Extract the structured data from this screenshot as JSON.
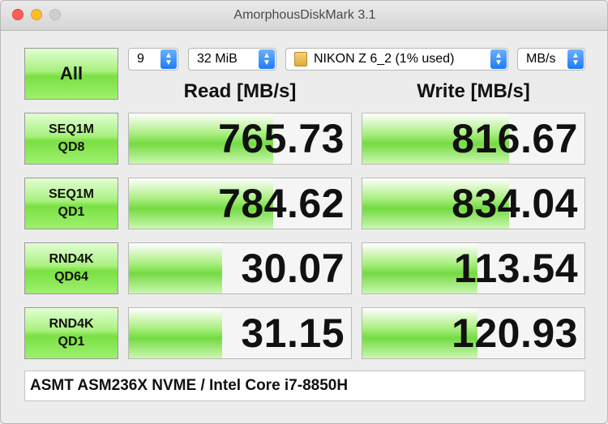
{
  "window": {
    "title": "AmorphousDiskMark 3.1"
  },
  "controls": {
    "all_label": "All",
    "count": "9",
    "size": "32 MiB",
    "drive": "NIKON Z 6_2 (1% used)",
    "unit": "MB/s"
  },
  "headers": {
    "read": "Read [MB/s]",
    "write": "Write [MB/s]"
  },
  "tests": [
    {
      "line1": "SEQ1M",
      "line2": "QD8",
      "read": "765.73",
      "write": "816.67",
      "read_fill": 0.65,
      "write_fill": 0.66
    },
    {
      "line1": "SEQ1M",
      "line2": "QD1",
      "read": "784.62",
      "write": "834.04",
      "read_fill": 0.65,
      "write_fill": 0.66
    },
    {
      "line1": "RND4K",
      "line2": "QD64",
      "read": "30.07",
      "write": "113.54",
      "read_fill": 0.42,
      "write_fill": 0.52
    },
    {
      "line1": "RND4K",
      "line2": "QD1",
      "read": "31.15",
      "write": "120.93",
      "read_fill": 0.42,
      "write_fill": 0.52
    }
  ],
  "comment": "ASMT ASM236X NVME / Intel Core i7-8850H"
}
